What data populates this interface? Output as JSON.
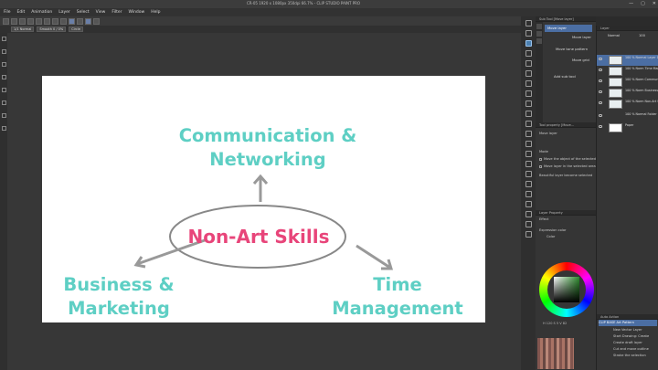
{
  "app": {
    "title": "CR-05 1920 x 1080px 350dpi 66.7% - CLIP STUDIO PAINT PRO",
    "window_controls": [
      "—",
      "▢",
      "✕"
    ]
  },
  "menu": [
    "File",
    "Edit",
    "Animation",
    "Layer",
    "Select",
    "View",
    "Filter",
    "Window",
    "Help"
  ],
  "tool_property_bar": {
    "fields": [
      "1/1 Normal",
      "Smooth 0 / 0%",
      "Circle"
    ]
  },
  "canvas": {
    "center_label": "Non-Art Skills",
    "top_label_line1": "Communication &",
    "top_label_line2": "Networking",
    "left_label_line1": "Business &",
    "left_label_line2": "Marketing",
    "right_label_line1": "Time",
    "right_label_line2": "Management"
  },
  "subtool_palette": {
    "header": "Sub Tool [Move layer]",
    "items": [
      "Move layer",
      "Move layer",
      "Move tone pattern",
      "Move grid"
    ],
    "add": "Add sub tool"
  },
  "tool_property_palette": {
    "header": "Tool property [Move...",
    "title": "Move layer",
    "mode_label": "Mode",
    "rows": [
      "Move the object of the selected...",
      "Move layer in the selected area",
      "Beautiful layer become selected"
    ]
  },
  "layer_property_palette": {
    "header": "Layer Property",
    "effect_label": "Effect",
    "expression_color_label": "Expression color",
    "expression_color_value": "Color"
  },
  "color_wheel": {
    "values": "H 120  S 5  V 82"
  },
  "layer_palette": {
    "header": "Layer",
    "blend_mode": "Normal",
    "opacity": "100",
    "layers": [
      {
        "name": "100 % Normal Layer 1"
      },
      {
        "name": "100 % Norm Time Manag..."
      },
      {
        "name": "100 % Norm Communic..."
      },
      {
        "name": "100 % Norm Business..."
      },
      {
        "name": "100 % Norm Non-Art Sk..."
      },
      {
        "name": "100 % Normal Folder 1"
      },
      {
        "name": "Paper"
      }
    ]
  },
  "auto_action": {
    "header": "Auto Action",
    "set": "CLIP BASE Art Pattern",
    "actions": [
      "New Vector Layer",
      "Start Drawing: Create",
      "Create draft layer",
      "Cut and move outline",
      "Stroke the selection"
    ]
  }
}
